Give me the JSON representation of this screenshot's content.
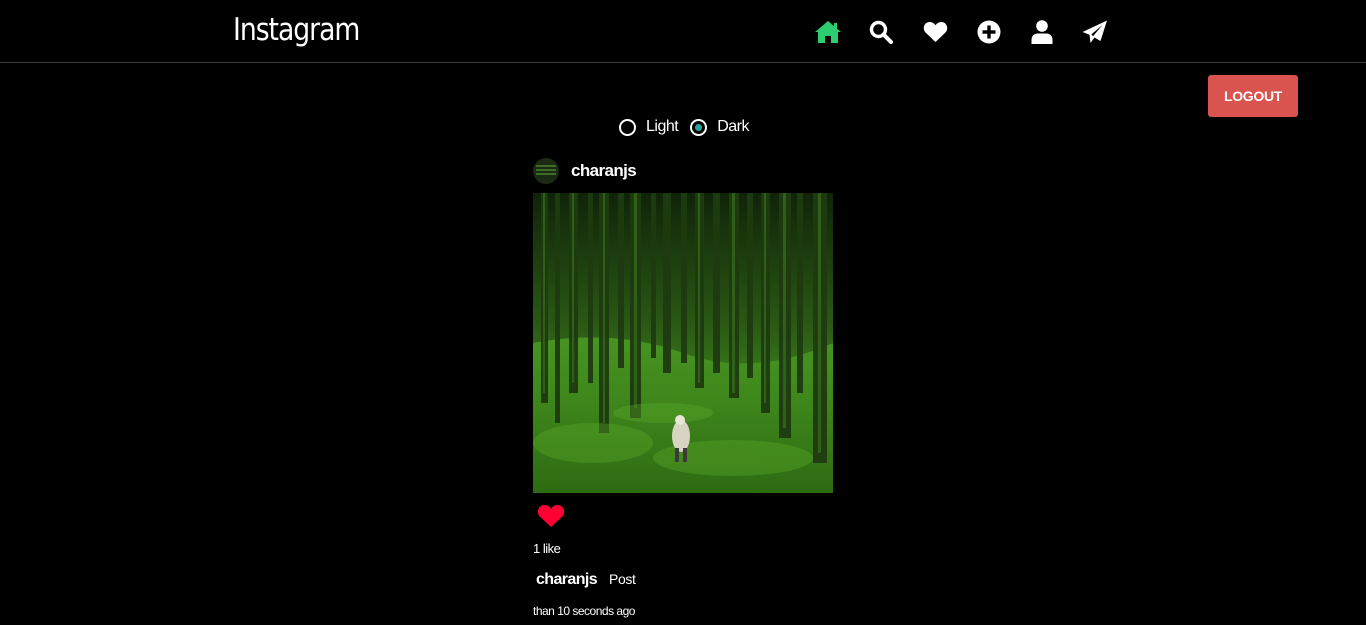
{
  "app": {
    "title": "Instagram"
  },
  "nav": {
    "items": [
      {
        "name": "home",
        "icon": "home-icon",
        "color": "#2ecc71",
        "active": true
      },
      {
        "name": "search",
        "icon": "search-icon",
        "color": "#ffffff",
        "active": false
      },
      {
        "name": "activity",
        "icon": "heart-icon",
        "color": "#ffffff",
        "active": false
      },
      {
        "name": "create",
        "icon": "plus-circle-icon",
        "color": "#ffffff",
        "active": false
      },
      {
        "name": "profile",
        "icon": "user-icon",
        "color": "#ffffff",
        "active": false
      },
      {
        "name": "messages",
        "icon": "paper-plane-icon",
        "color": "#ffffff",
        "active": false
      }
    ]
  },
  "logout": {
    "label": "LOGOUT",
    "color": "#d9534f"
  },
  "theme": {
    "options": [
      {
        "label": "Light",
        "checked": false
      },
      {
        "label": "Dark",
        "checked": true
      }
    ],
    "accent": "#26a69a"
  },
  "post": {
    "username": "charanjs",
    "image": "forest-photo",
    "liked": true,
    "heart_color": "#ff0033",
    "likes": "1 like",
    "caption_user": "charanjs",
    "caption_text": "Post",
    "timestamp": "than 10 seconds ago"
  }
}
